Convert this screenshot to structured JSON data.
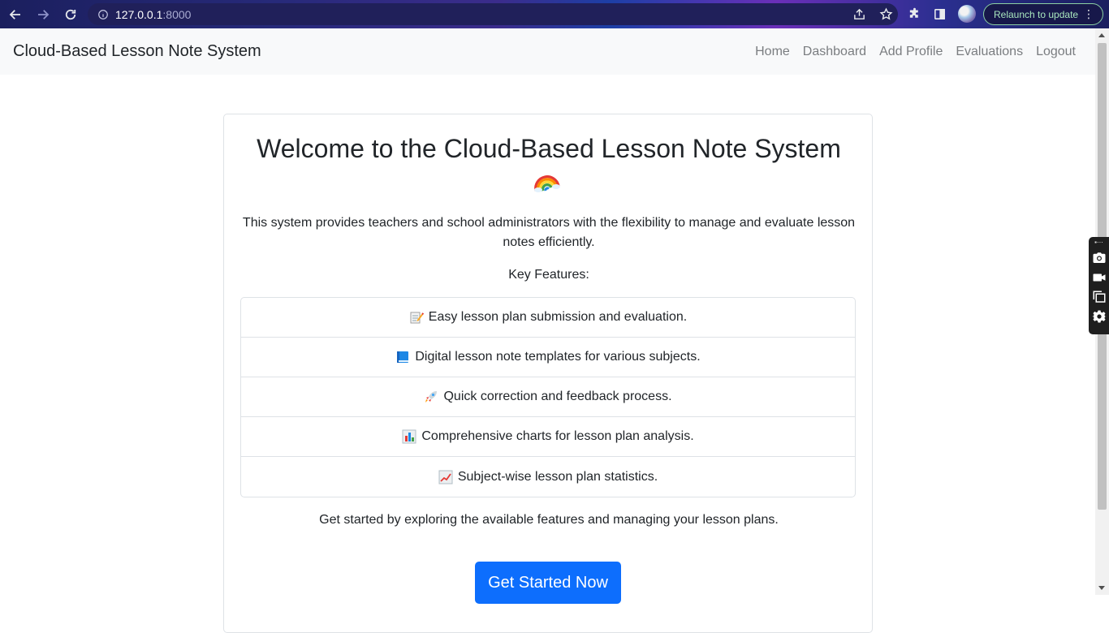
{
  "browser": {
    "url_host": "127.0.0.1",
    "url_port": ":8000",
    "relaunch_label": "Relaunch to update"
  },
  "navbar": {
    "brand": "Cloud-Based Lesson Note System",
    "links": [
      "Home",
      "Dashboard",
      "Add Profile",
      "Evaluations",
      "Logout"
    ]
  },
  "main": {
    "title": "Welcome to the Cloud-Based Lesson Note System",
    "title_emoji_icon": "rainbow-icon",
    "description": "This system provides teachers and school administrators with the flexibility to manage and evaluate lesson notes efficiently.",
    "key_features_heading": "Key Features:",
    "features": [
      {
        "icon": "memo-icon",
        "text": "Easy lesson plan submission and evaluation."
      },
      {
        "icon": "blue-book-icon",
        "text": "Digital lesson note templates for various subjects."
      },
      {
        "icon": "rocket-icon",
        "text": "Quick correction and feedback process."
      },
      {
        "icon": "bar-chart-icon",
        "text": "Comprehensive charts for lesson plan analysis."
      },
      {
        "icon": "chart-increasing-icon",
        "text": "Subject-wise lesson plan statistics."
      }
    ],
    "get_started_text": "Get started by exploring the available features and managing your lesson plans.",
    "cta_label": "Get Started Now"
  },
  "colors": {
    "primary": "#0d6efd",
    "navbar_bg": "#f8f9fa",
    "nav_link": "#7a7d80"
  }
}
